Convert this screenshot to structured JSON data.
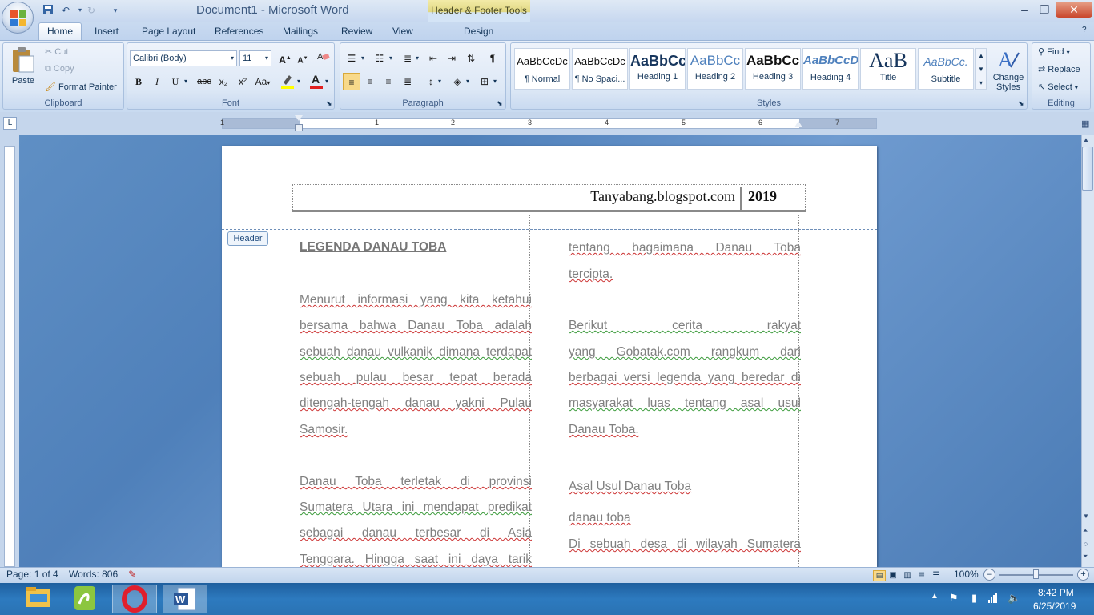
{
  "window": {
    "title": "Document1 - Microsoft Word",
    "contextual_tab_group": "Header & Footer Tools",
    "controls": {
      "minimize": "–",
      "maximize": "❐",
      "close": "✕"
    }
  },
  "tabs": [
    "Home",
    "Insert",
    "Page Layout",
    "References",
    "Mailings",
    "Review",
    "View",
    "Design"
  ],
  "ribbon": {
    "clipboard": {
      "label": "Clipboard",
      "paste": "Paste",
      "cut": "Cut",
      "copy": "Copy",
      "format_painter": "Format Painter"
    },
    "font": {
      "label": "Font",
      "font_name": "Calibri (Body)",
      "font_size": "11",
      "bold": "B",
      "italic": "I",
      "underline": "U",
      "strike": "abc",
      "subscript": "x₂",
      "superscript": "x²",
      "change_case": "Aa",
      "grow": "A",
      "shrink": "A"
    },
    "paragraph": {
      "label": "Paragraph"
    },
    "styles": {
      "label": "Styles",
      "items": [
        {
          "sample": "AaBbCcDc",
          "name": "¶ Normal"
        },
        {
          "sample": "AaBbCcDc",
          "name": "¶ No Spaci..."
        },
        {
          "sample": "AaBbCc",
          "name": "Heading 1"
        },
        {
          "sample": "AaBbCc",
          "name": "Heading 2"
        },
        {
          "sample": "AaBbCc",
          "name": "Heading 3"
        },
        {
          "sample": "AaBbCcD",
          "name": "Heading 4"
        },
        {
          "sample": "AaB",
          "name": "Title"
        },
        {
          "sample": "AaBbCc.",
          "name": "Subtitle"
        }
      ],
      "change_styles": "Change Styles"
    },
    "editing": {
      "label": "Editing",
      "find": "Find",
      "replace": "Replace",
      "select": "Select"
    }
  },
  "ruler": {
    "numbers": [
      "1",
      "1",
      "2",
      "3",
      "4",
      "5",
      "6",
      "7"
    ],
    "tab_selector": "L"
  },
  "document": {
    "header": {
      "site": "Tanyabang.blogspot.com",
      "year": "2019",
      "tag": "Header"
    },
    "heading": "LEGENDA DANAU TOBA",
    "col1": [
      "Menurut informasi yang kita ketahui",
      "bersama bahwa Danau Toba adalah",
      "sebuah danau vulkanik dimana terdapat",
      "sebuah pulau besar tepat berada",
      "ditengah-tengah danau yakni Pulau",
      "Samosir.",
      "Danau Toba terletak di provinsi",
      "Sumatera Utara ini mendapat predikat",
      "sebagai danau terbesar di Asia",
      "Tenggara. Hingga saat ini daya tarik"
    ],
    "col2": [
      "tentang bagaimana Danau Toba",
      "tercipta.",
      "Berikut cerita rakyat",
      "yang Gobatak.com rangkum dari",
      "berbagai versi legenda yang beredar di",
      "masyarakat luas tentang asal usul",
      "Danau Toba.",
      "Asal Usul Danau Toba",
      "danau toba",
      "Di sebuah desa di wilayah Sumatera"
    ]
  },
  "statusbar": {
    "page": "Page: 1 of 4",
    "words": "Words: 806",
    "zoom": "100%"
  },
  "taskbar": {
    "time": "8:42 PM",
    "date": "6/25/2019"
  }
}
